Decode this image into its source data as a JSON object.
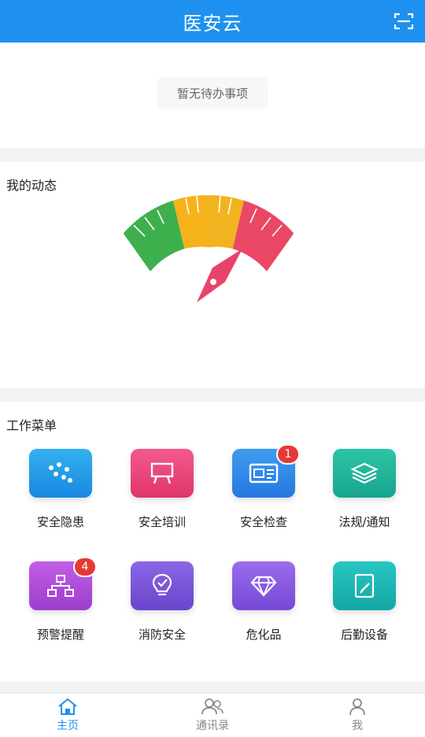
{
  "header": {
    "title": "医安云",
    "scan_icon": "scan-icon"
  },
  "todo": {
    "empty_text": "暂无待办事项"
  },
  "dynamics": {
    "title": "我的动态"
  },
  "menu": {
    "title": "工作菜单",
    "items": [
      {
        "label": "安全隐患",
        "icon": "dots-icon",
        "color": "#1f95e8"
      },
      {
        "label": "安全培训",
        "icon": "easel-icon",
        "color": "#ec3f79"
      },
      {
        "label": "安全检查",
        "icon": "id-card-icon",
        "color": "#2f87e8",
        "badge": "1"
      },
      {
        "label": "法规/通知",
        "icon": "layers-icon",
        "color": "#1fb39a"
      },
      {
        "label": "预警提醒",
        "icon": "hierarchy-icon",
        "color": "#b34fd6",
        "badge": "4"
      },
      {
        "label": "消防安全",
        "icon": "bulb-icon",
        "color": "#7b55d8"
      },
      {
        "label": "危化品",
        "icon": "diamond-icon",
        "color": "#8a5ae0"
      },
      {
        "label": "后勤设备",
        "icon": "tablet-edit-icon",
        "color": "#19b4b2"
      }
    ]
  },
  "tabbar": {
    "tabs": [
      {
        "label": "主页",
        "icon": "home-icon",
        "active": true
      },
      {
        "label": "通讯录",
        "icon": "contacts-icon",
        "active": false
      },
      {
        "label": "我",
        "icon": "person-icon",
        "active": false
      }
    ],
    "active_color": "#1e90ef"
  }
}
